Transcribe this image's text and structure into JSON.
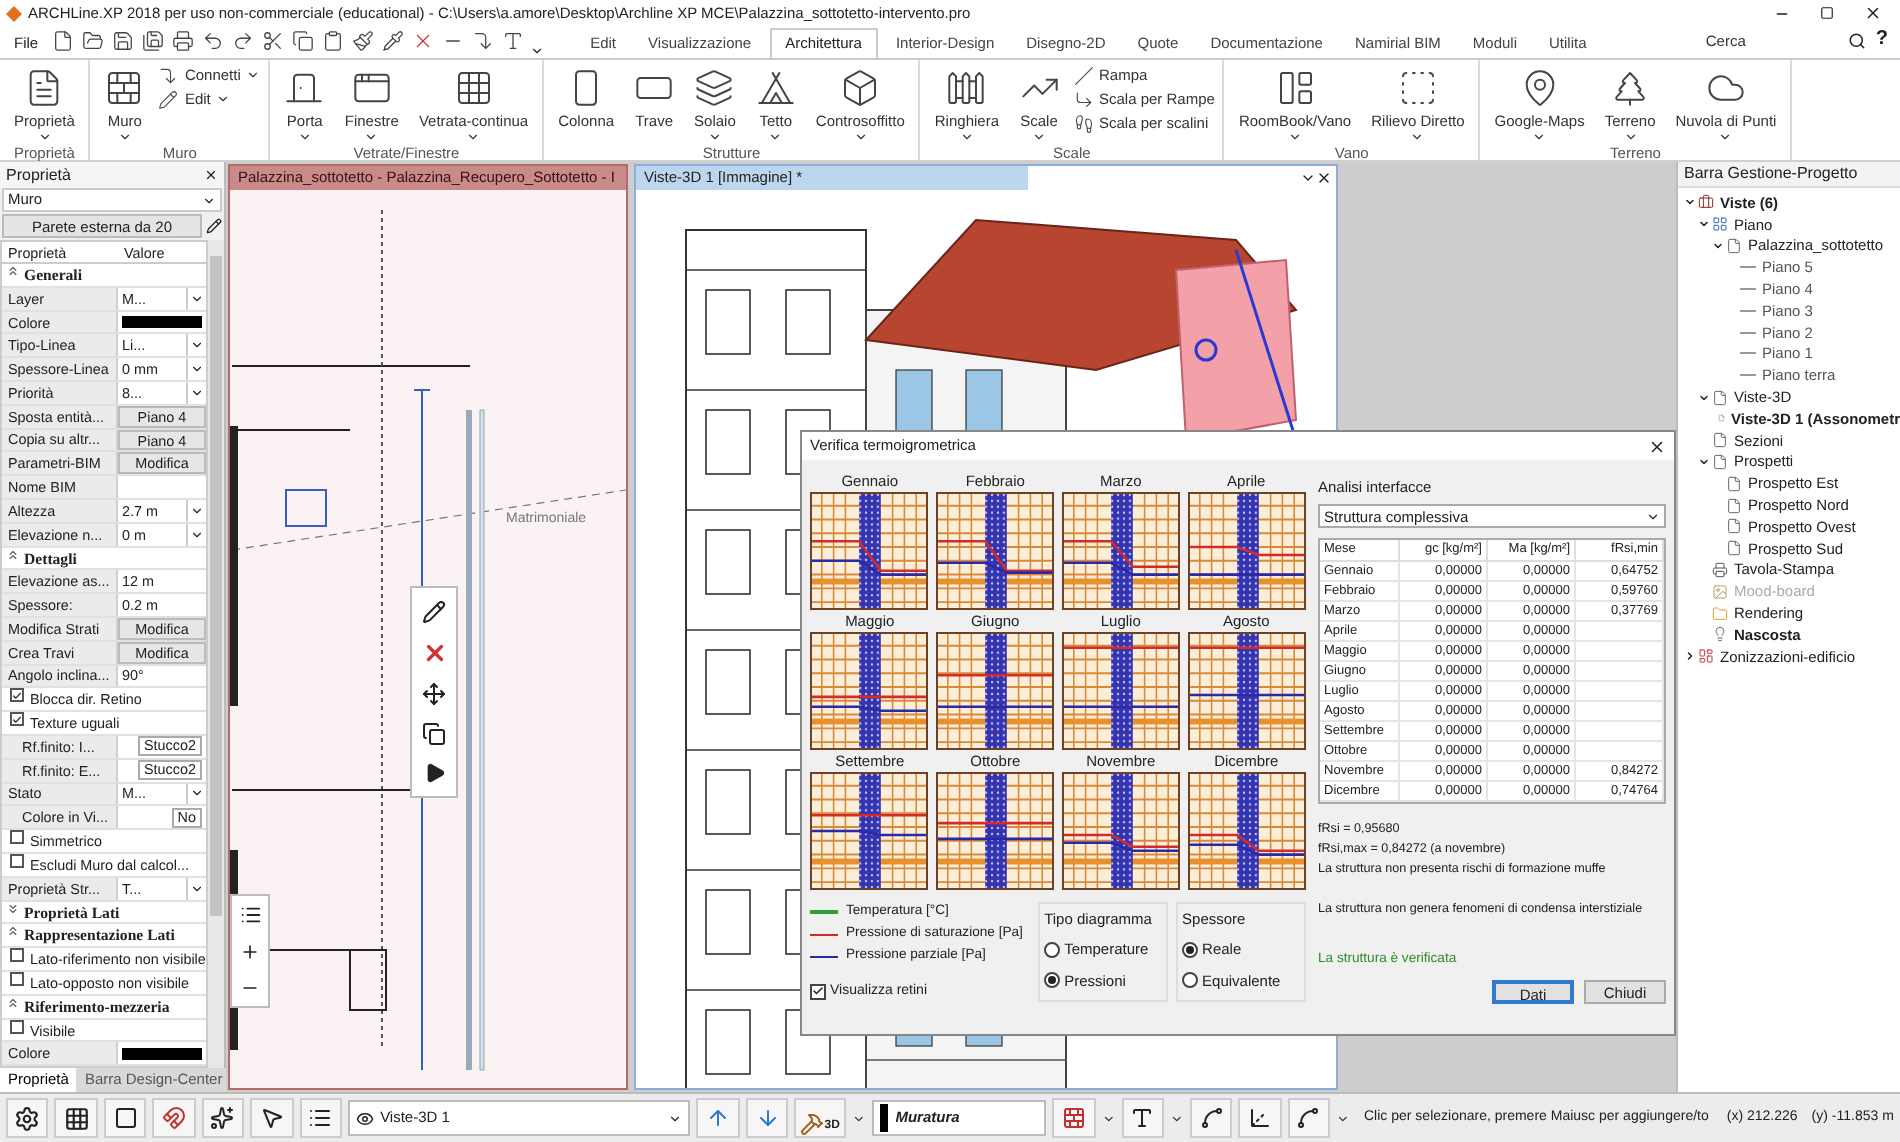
{
  "window": {
    "title": "ARCHLine.XP 2018 per uso non-commerciale (educational) -  C:\\Users\\a.amore\\Desktop\\Archline XP MCE\\Palazzina_sottotetto-intervento.pro"
  },
  "menu": {
    "file": "File",
    "tabs": [
      {
        "label": "Edit",
        "selected": false
      },
      {
        "label": "Visualizzazione",
        "selected": false
      },
      {
        "label": "Architettura",
        "selected": true
      },
      {
        "label": "Interior-Design",
        "selected": false
      },
      {
        "label": "Disegno-2D",
        "selected": false
      },
      {
        "label": "Quote",
        "selected": false
      },
      {
        "label": "Documentazione",
        "selected": false
      },
      {
        "label": "Namirial BIM",
        "selected": false
      },
      {
        "label": "Moduli",
        "selected": false
      },
      {
        "label": "Utilita",
        "selected": false
      }
    ],
    "search": {
      "placeholder": "Cerca"
    },
    "help": "?"
  },
  "ribbon": {
    "groups": [
      {
        "label": "Proprietà",
        "tools": [
          {
            "label": "Proprietà",
            "kind": "large",
            "has_menu": true
          }
        ]
      },
      {
        "label": "Muro",
        "tools": [
          {
            "label": "Muro",
            "kind": "large",
            "has_menu": true
          },
          {
            "label": "Connetti",
            "kind": "small",
            "has_menu": true
          },
          {
            "label": "Edit",
            "kind": "small",
            "has_menu": true
          }
        ]
      },
      {
        "label": "Vetrate/Finestre",
        "tools": [
          {
            "label": "Porta",
            "kind": "large",
            "has_menu": true
          },
          {
            "label": "Finestre",
            "kind": "large",
            "has_menu": true
          },
          {
            "label": "Vetrata-continua",
            "kind": "large",
            "has_menu": true
          }
        ]
      },
      {
        "label": "Strutture",
        "tools": [
          {
            "label": "Colonna",
            "kind": "large",
            "has_menu": false
          },
          {
            "label": "Trave",
            "kind": "large",
            "has_menu": false
          },
          {
            "label": "Solaio",
            "kind": "large",
            "has_menu": true
          },
          {
            "label": "Tetto",
            "kind": "large",
            "has_menu": true
          },
          {
            "label": "Controsoffitto",
            "kind": "large",
            "has_menu": true
          }
        ]
      },
      {
        "label": "Scale",
        "tools": [
          {
            "label": "Ringhiera",
            "kind": "large",
            "has_menu": true
          },
          {
            "label": "Scale",
            "kind": "large",
            "has_menu": true
          },
          {
            "label": "Rampa",
            "kind": "small",
            "has_menu": false
          },
          {
            "label": "Scala per Rampe",
            "kind": "small",
            "has_menu": false
          },
          {
            "label": "Scala per scalini",
            "kind": "small",
            "has_menu": false
          }
        ]
      },
      {
        "label": "Vano",
        "tools": [
          {
            "label": "RoomBook/Vano",
            "kind": "large",
            "has_menu": true
          },
          {
            "label": "Rilievo Diretto",
            "kind": "large",
            "has_menu": true
          }
        ]
      },
      {
        "label": "Terreno",
        "tools": [
          {
            "label": "Google-Maps",
            "kind": "large",
            "has_menu": true
          },
          {
            "label": "Terreno",
            "kind": "large",
            "has_menu": true
          },
          {
            "label": "Nuvola di Punti",
            "kind": "large",
            "has_menu": true
          }
        ]
      }
    ]
  },
  "properties_panel": {
    "title": "Proprietà",
    "object_type": "Muro",
    "wall_type": "Parete esterna da 20",
    "columns": [
      "Proprietà",
      "Valore"
    ],
    "rows": [
      {
        "kind": "section",
        "label": "Generali",
        "expanded": true
      },
      {
        "kind": "dropdown",
        "label": "Layer",
        "value": "M..."
      },
      {
        "kind": "swatch",
        "label": "Colore"
      },
      {
        "kind": "dropdown",
        "label": "Tipo-Linea",
        "value": "Li..."
      },
      {
        "kind": "dropdown",
        "label": "Spessore-Linea",
        "value": "0 mm"
      },
      {
        "kind": "dropdown",
        "label": "Priorità",
        "value": "8..."
      },
      {
        "kind": "button",
        "label": "Sposta entità...",
        "value": "Piano 4"
      },
      {
        "kind": "button",
        "label": "Copia su altr...",
        "value": "Piano 4"
      },
      {
        "kind": "button",
        "label": "Parametri-BIM",
        "value": "Modifica"
      },
      {
        "kind": "text",
        "label": "Nome BIM"
      },
      {
        "kind": "dropdown",
        "label": "Altezza",
        "value": "2.7 m"
      },
      {
        "kind": "dropdown",
        "label": "Elevazione n...",
        "value": "0 m"
      },
      {
        "kind": "section",
        "label": "Dettagli",
        "expanded": true
      },
      {
        "kind": "text",
        "label": "Elevazione as...",
        "value": "12 m"
      },
      {
        "kind": "text",
        "label": "Spessore:",
        "value": "0.2 m"
      },
      {
        "kind": "button",
        "label": "Modifica Strati",
        "value": "Modifica"
      },
      {
        "kind": "button",
        "label": "Crea Travi",
        "value": "Modifica"
      },
      {
        "kind": "text",
        "label": "Angolo inclina...",
        "value": "90°"
      },
      {
        "kind": "check",
        "label": "Blocca dir. Retino",
        "checked": true
      },
      {
        "kind": "check",
        "label": "Texture uguali",
        "checked": true
      },
      {
        "kind": "field",
        "label": "Rf.finito: I...",
        "value": "Stucco2"
      },
      {
        "kind": "field",
        "label": "Rf.finito: E...",
        "value": "Stucco2"
      },
      {
        "kind": "dropdown",
        "label": "Stato",
        "value": "M..."
      },
      {
        "kind": "field",
        "label": "Colore in Vi...",
        "value": "No"
      },
      {
        "kind": "check",
        "label": "Simmetrico",
        "checked": false
      },
      {
        "kind": "check",
        "label": "Escludi Muro dal calcol...",
        "checked": false
      },
      {
        "kind": "dropdown",
        "label": "Proprietà Str...",
        "value": "T..."
      },
      {
        "kind": "section",
        "label": "Proprietà Lati",
        "expanded": false
      },
      {
        "kind": "section",
        "label": "Rappresentazione Lati",
        "expanded": true
      },
      {
        "kind": "check",
        "label": "Lato-riferimento non visibile",
        "checked": false
      },
      {
        "kind": "check",
        "label": "Lato-opposto non visibile",
        "checked": false
      },
      {
        "kind": "section",
        "label": "Riferimento-mezzeria",
        "expanded": true
      },
      {
        "kind": "check",
        "label": "Visibile",
        "checked": false
      },
      {
        "kind": "swatch",
        "label": "Colore"
      }
    ],
    "tabs": [
      {
        "label": "Proprietà",
        "selected": true
      },
      {
        "label": "Barra Design-Center",
        "selected": false
      }
    ]
  },
  "plan_view": {
    "title": "Palazzina_sottotetto - Palazzina_Recupero_Sottotetto - I",
    "labels": [
      "Matrimoniale"
    ]
  },
  "view_3d": {
    "title": "Viste-3D 1 [Immagine] *"
  },
  "dialog": {
    "title": "Verifica termoigrometrica",
    "months": [
      "Gennaio",
      "Febbraio",
      "Marzo",
      "Aprile",
      "Maggio",
      "Giugno",
      "Luglio",
      "Agosto",
      "Settembre",
      "Ottobre",
      "Novembre",
      "Dicembre"
    ],
    "legend": [
      {
        "label": "Temperatura [°C]",
        "color": "#2e9e3e"
      },
      {
        "label": "Pressione di saturazione [Pa]",
        "color": "#d42a2a"
      },
      {
        "label": "Pressione parziale [Pa]",
        "color": "#2a2aa8"
      }
    ],
    "diagram_type": {
      "title": "Tipo diagramma",
      "options": [
        {
          "label": "Temperature",
          "selected": false
        },
        {
          "label": "Pressioni",
          "selected": true
        }
      ]
    },
    "thickness": {
      "title": "Spessore",
      "options": [
        {
          "label": "Reale",
          "selected": true
        },
        {
          "label": "Equivalente",
          "selected": false
        }
      ]
    },
    "show_hatching": {
      "label": "Visualizza retini",
      "checked": true
    },
    "analysis_label": "Analisi interfacce",
    "analysis_select": "Struttura complessiva",
    "table": {
      "columns": [
        "Mese",
        "gc [kg/m²]",
        "Ma [kg/m²]",
        "fRsi,min"
      ],
      "rows": [
        [
          "Gennaio",
          "0,00000",
          "0,00000",
          "0,64752"
        ],
        [
          "Febbraio",
          "0,00000",
          "0,00000",
          "0,59760"
        ],
        [
          "Marzo",
          "0,00000",
          "0,00000",
          "0,37769"
        ],
        [
          "Aprile",
          "0,00000",
          "0,00000"
        ],
        [
          "Maggio",
          "0,00000",
          "0,00000"
        ],
        [
          "Giugno",
          "0,00000",
          "0,00000"
        ],
        [
          "Luglio",
          "0,00000",
          "0,00000"
        ],
        [
          "Agosto",
          "0,00000",
          "0,00000"
        ],
        [
          "Settembre",
          "0,00000",
          "0,00000"
        ],
        [
          "Ottobre",
          "0,00000",
          "0,00000"
        ],
        [
          "Novembre",
          "0,00000",
          "0,00000",
          "0,84272"
        ],
        [
          "Dicembre",
          "0,00000",
          "0,00000",
          "0,74764"
        ]
      ]
    },
    "results": [
      "fRsi = 0,95680",
      "fRsi,max = 0,84272 (a novembre)",
      "La struttura non presenta rischi di formazione muffe",
      "La struttura non genera fenomeni di condensa interstiziale"
    ],
    "verdict": "La struttura è verificata",
    "buttons": [
      {
        "label": "Dati",
        "default": true
      },
      {
        "label": "Chiudi",
        "default": false
      }
    ]
  },
  "project_panel": {
    "title": "Barra Gestione-Progetto",
    "tree": [
      {
        "label": "Viste (6)",
        "kind": "views",
        "bold": true,
        "expanded": true,
        "children": [
          {
            "label": "Piano",
            "kind": "plan",
            "bold": false,
            "expanded": true,
            "children": [
              {
                "label": "Palazzina_sottotetto",
                "kind": "document",
                "bold": false,
                "expanded": true,
                "children": [
                  {
                    "label": "Piano 5",
                    "kind": "level",
                    "bold": false
                  },
                  {
                    "label": "Piano 4",
                    "kind": "level",
                    "bold": false
                  },
                  {
                    "label": "Piano 3",
                    "kind": "level",
                    "bold": false
                  },
                  {
                    "label": "Piano 2",
                    "kind": "level",
                    "bold": false
                  },
                  {
                    "label": "Piano 1",
                    "kind": "level",
                    "bold": false
                  },
                  {
                    "label": "Piano terra",
                    "kind": "level",
                    "bold": false
                  }
                ]
              }
            ]
          },
          {
            "label": "Viste-3D",
            "kind": "document",
            "bold": false,
            "expanded": true,
            "children": [
              {
                "label": "Viste-3D 1 (Assonometr",
                "kind": "document",
                "bold": true
              }
            ]
          },
          {
            "label": "Sezioni",
            "kind": "document",
            "bold": false
          },
          {
            "label": "Prospetti",
            "kind": "document",
            "bold": false,
            "expanded": true,
            "children": [
              {
                "label": "Prospetto Est",
                "kind": "document",
                "bold": false
              },
              {
                "label": "Prospetto Nord",
                "kind": "document",
                "bold": false
              },
              {
                "label": "Prospetto Ovest",
                "kind": "document",
                "bold": false
              },
              {
                "label": "Prospetto Sud",
                "kind": "document",
                "bold": false
              }
            ]
          },
          {
            "label": "Tavola-Stampa",
            "kind": "print",
            "bold": false
          },
          {
            "label": "Mood-board",
            "kind": "board",
            "bold": false,
            "disabled": true
          },
          {
            "label": "Rendering",
            "kind": "folder",
            "bold": false
          },
          {
            "label": "Nascosta",
            "kind": "hidden",
            "bold": true
          }
        ]
      },
      {
        "label": "Zonizzazioni-edificio",
        "kind": "zones",
        "bold": false,
        "expanded": false
      }
    ]
  },
  "bottom_bar": {
    "view": "Viste-3D 1",
    "badge": "3D",
    "layer": "Muratura",
    "status": "Clic per selezionare, premere Maiusc per aggiungere/to",
    "x": "(x) 212.226",
    "y": "(y) -11.853 m"
  }
}
